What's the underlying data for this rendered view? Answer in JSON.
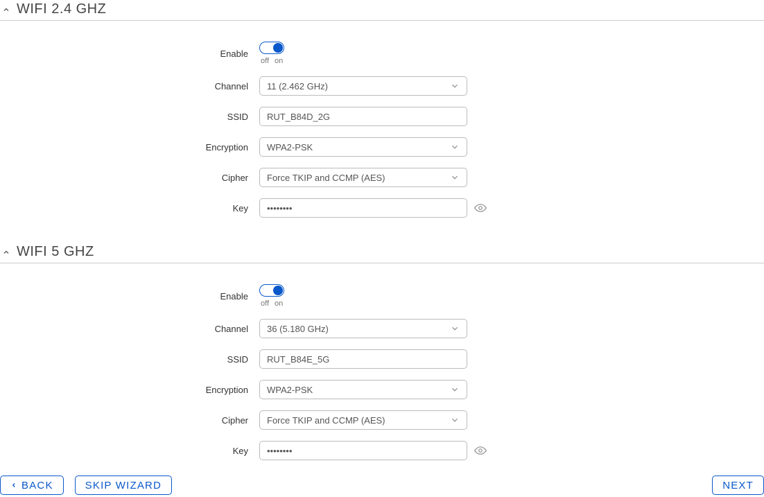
{
  "sections": {
    "wifi24": {
      "title": "WIFI 2.4 GHZ",
      "enable": {
        "label": "Enable",
        "value": true,
        "off": "off",
        "on": "on"
      },
      "channel": {
        "label": "Channel",
        "value": "11 (2.462 GHz)"
      },
      "ssid": {
        "label": "SSID",
        "value": "RUT_B84D_2G"
      },
      "encryption": {
        "label": "Encryption",
        "value": "WPA2-PSK"
      },
      "cipher": {
        "label": "Cipher",
        "value": "Force TKIP and CCMP (AES)"
      },
      "key": {
        "label": "Key",
        "value": "••••••••"
      }
    },
    "wifi5": {
      "title": "WIFI 5 GHZ",
      "enable": {
        "label": "Enable",
        "value": true,
        "off": "off",
        "on": "on"
      },
      "channel": {
        "label": "Channel",
        "value": "36 (5.180 GHz)"
      },
      "ssid": {
        "label": "SSID",
        "value": "RUT_B84E_5G"
      },
      "encryption": {
        "label": "Encryption",
        "value": "WPA2-PSK"
      },
      "cipher": {
        "label": "Cipher",
        "value": "Force TKIP and CCMP (AES)"
      },
      "key": {
        "label": "Key",
        "value": "••••••••"
      }
    }
  },
  "footer": {
    "back": "BACK",
    "skip": "SKIP WIZARD",
    "next": "NEXT"
  },
  "colors": {
    "accent": "#0a58ca",
    "border": "#bbbbbb",
    "text": "#333333"
  }
}
